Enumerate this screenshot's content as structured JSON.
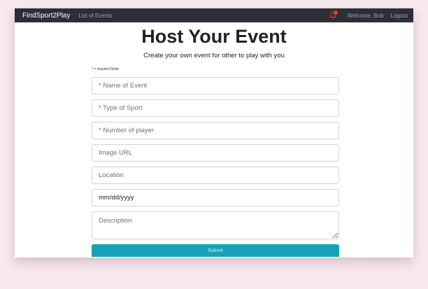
{
  "navbar": {
    "brand": "FindSport2Play",
    "list_events": "List of Events",
    "welcome": "Welcome, Bob",
    "logout": "Logout"
  },
  "header": {
    "title": "Host Your Event",
    "subtitle": "Create your own event for other to play with you",
    "required_note": "* = required fields"
  },
  "form": {
    "event_name_placeholder": "* Name of Event",
    "sport_type_placeholder": "* Type of Sport",
    "player_count_placeholder": "* Number of player",
    "image_url_placeholder": "Image URL",
    "location_placeholder": "Location",
    "date_value": "mm/dd/yyyy",
    "description_placeholder": "Description",
    "submit_label": "Submit"
  },
  "colors": {
    "navbar_bg": "#2d2f36",
    "submit_bg": "#17a2b8",
    "notification_badge": "#e0403a"
  },
  "icons": {
    "notification": "bell-icon"
  }
}
